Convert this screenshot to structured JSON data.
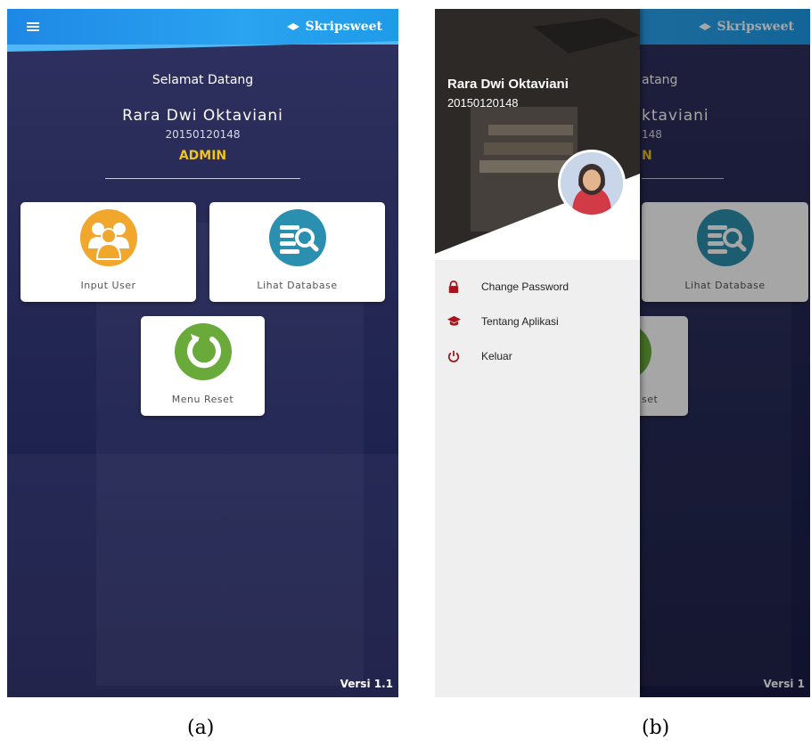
{
  "panel_a": {
    "app_logo_text": "Skripsweet",
    "greeting": "Selamat Datang",
    "user_name": "Rara Dwi Oktaviani",
    "user_id": "20150120148",
    "role": "ADMIN",
    "cards": [
      {
        "label": "Input User",
        "icon": "users-icon",
        "color": "#f0a72c"
      },
      {
        "label": "Lihat Database",
        "icon": "database-search-icon",
        "color": "#2b8fb0"
      },
      {
        "label": "Menu Reset",
        "icon": "reset-icon",
        "color": "#6aaa3a"
      }
    ],
    "version": "Versi 1.1",
    "caption": "(a)"
  },
  "panel_b": {
    "app_logo_text": "Skripsweet",
    "greeting_partial": "atang",
    "name_partial": "ktaviani",
    "id_partial": "148",
    "role_partial": "N",
    "card_label": "Lihat Database",
    "reset_partial": "set",
    "version_partial": "Versi 1",
    "drawer": {
      "user_name": "Rara Dwi Oktaviani",
      "user_id": "20150120148",
      "menu": [
        {
          "label": "Change Password",
          "icon": "lock-icon"
        },
        {
          "label": "Tentang Aplikasi",
          "icon": "graduation-cap-icon"
        },
        {
          "label": "Keluar",
          "icon": "power-icon"
        }
      ]
    },
    "caption": "(b)"
  },
  "colors": {
    "topbar": "#1e88e5",
    "background": "#262955",
    "role": "#f2c418",
    "drawer_icon": "#a8141c"
  }
}
